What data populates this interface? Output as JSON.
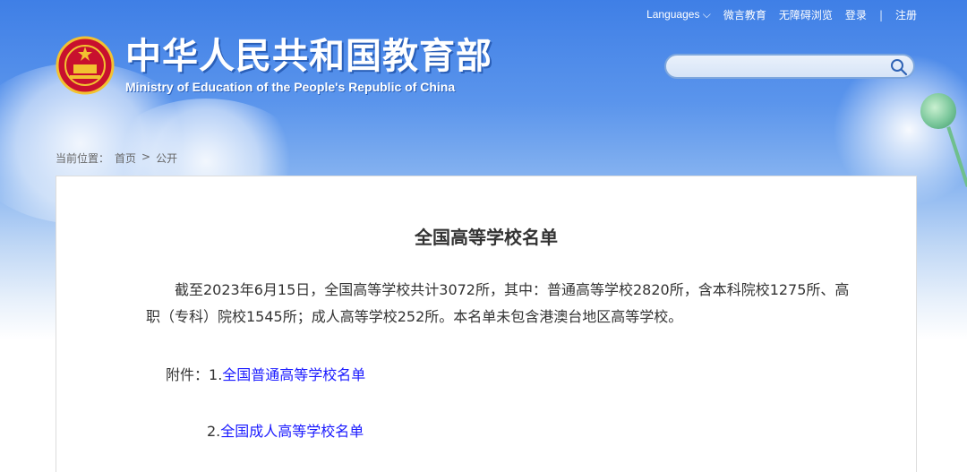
{
  "header": {
    "links": [
      "Languages",
      "微言教育",
      "无障碍浏览",
      "登录",
      "注册"
    ],
    "title_cn": "中华人民共和国教育部",
    "title_en": "Ministry of Education of the People's Republic of China"
  },
  "breadcrumb": {
    "prefix": "当前位置：",
    "items": [
      "首页",
      "公开"
    ],
    "separator": ">"
  },
  "article": {
    "title": "全国高等学校名单",
    "body": "截至2023年6月15日，全国高等学校共计3072所，其中：普通高等学校2820所，含本科院校1275所、高职（专科）院校1545所；成人高等学校252所。本名单未包含港澳台地区高等学校。",
    "attachments_label": "附件：",
    "attachments": [
      {
        "number": "1.",
        "text": "全国普通高等学校名单"
      },
      {
        "number": "2.",
        "text": "全国成人高等学校名单"
      }
    ]
  },
  "colors": {
    "link": "#1a1aff",
    "accent": "#3f7fe6"
  }
}
